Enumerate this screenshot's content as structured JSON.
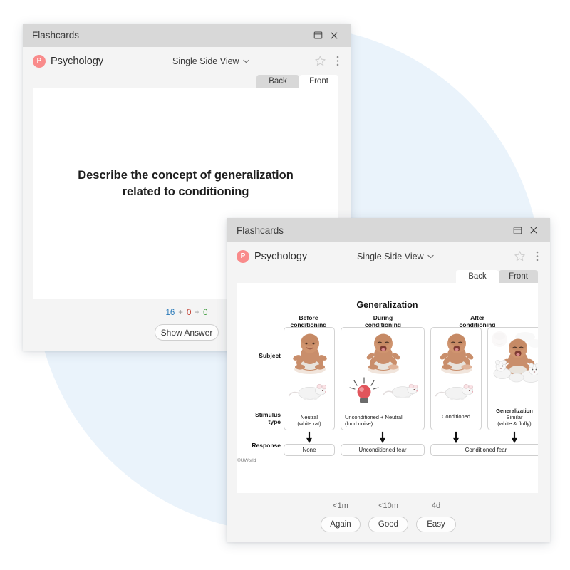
{
  "background": {
    "accent_circle_color": "#eaf3fb"
  },
  "window1": {
    "titlebar": {
      "title": "Flashcards",
      "restore_icon": "restore-window-icon",
      "close_icon": "close-icon"
    },
    "header": {
      "avatar_letter": "P",
      "deck_name": "Psychology",
      "view_mode": "Single Side View",
      "chevron_icon": "chevron-down-icon",
      "star_icon": "star-icon",
      "more_icon": "more-vertical-icon"
    },
    "tabs": [
      {
        "label": "Back",
        "active": false
      },
      {
        "label": "Front",
        "active": true
      }
    ],
    "card": {
      "prompt_line1": "Describe the concept of generalization",
      "prompt_line2": "related to conditioning"
    },
    "footer": {
      "counts": {
        "new": "16",
        "separator": "+",
        "learning": "0",
        "due": "0"
      },
      "count_colors": {
        "new": "#2a7ab9",
        "learning": "#c0392b",
        "due": "#3a9a3a"
      },
      "show_answer_label": "Show Answer"
    }
  },
  "window2": {
    "titlebar": {
      "title": "Flashcards",
      "restore_icon": "restore-window-icon",
      "close_icon": "close-icon"
    },
    "header": {
      "avatar_letter": "P",
      "deck_name": "Psychology",
      "view_mode": "Single Side View",
      "chevron_icon": "chevron-down-icon",
      "star_icon": "star-icon",
      "more_icon": "more-vertical-icon"
    },
    "tabs": [
      {
        "label": "Back",
        "active": true
      },
      {
        "label": "Front",
        "active": false
      }
    ],
    "diagram": {
      "title": "Generalization",
      "row_labels": {
        "subject": "Subject",
        "stimulus_l1": "Stimulus",
        "stimulus_l2": "type",
        "response": "Response"
      },
      "phases": [
        {
          "line1": "Before",
          "line2": "conditioning"
        },
        {
          "line1": "During",
          "line2": "conditioning"
        },
        {
          "line1": "After",
          "line2": "conditioning"
        }
      ],
      "panels": [
        {
          "caption_bold": "",
          "caption_l1": "Neutral",
          "caption_l2": "(white rat)"
        },
        {
          "caption_bold": "",
          "caption_l1": "Unconditioned",
          "caption_l2": "(loud noise)"
        },
        {
          "caption_bold": "",
          "caption_l1": "Neutral",
          "caption_l2": ""
        },
        {
          "caption_bold": "",
          "caption_l1": "Conditioned",
          "caption_l2": ""
        },
        {
          "caption_bold": "Generalization",
          "caption_l1": "Similar",
          "caption_l2": "(white & fluffy)"
        }
      ],
      "plus_symbol": "+",
      "responses": [
        {
          "label": "None"
        },
        {
          "label": "Unconditioned fear"
        },
        {
          "label": "Conditioned fear"
        }
      ],
      "copyright": "©UWorld"
    },
    "footer": {
      "intervals": [
        "<1m",
        "<10m",
        "4d"
      ],
      "answers": [
        "Again",
        "Good",
        "Easy"
      ]
    }
  }
}
